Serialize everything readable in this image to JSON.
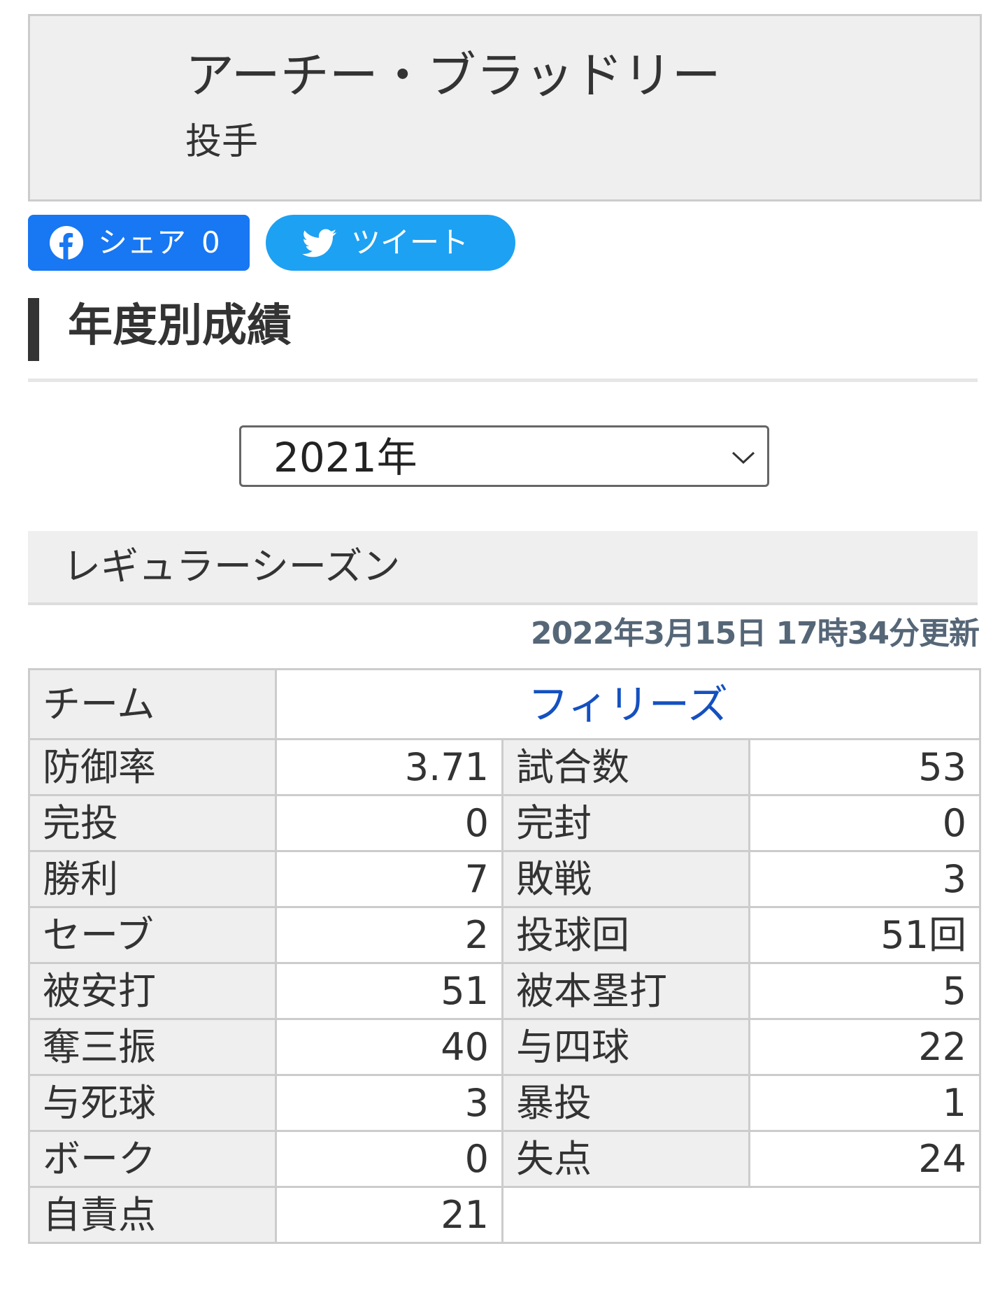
{
  "player": {
    "name": "アーチー・ブラッドリー",
    "position": "投手"
  },
  "share": {
    "facebook_label": "シェア",
    "facebook_count": "0",
    "tweet_label": "ツイート",
    "facebook_color": "#1877f2",
    "twitter_color": "#1da1f2"
  },
  "section": {
    "title": "年度別成績"
  },
  "year_select": {
    "value": "2021年"
  },
  "season": {
    "title": "レギュラーシーズン",
    "updated": "2022年3月15日 17時34分更新"
  },
  "stats": {
    "team_label": "チーム",
    "team_name": "フィリーズ",
    "rows": [
      [
        "防御率",
        "3.71",
        "試合数",
        "53"
      ],
      [
        "完投",
        "0",
        "完封",
        "0"
      ],
      [
        "勝利",
        "7",
        "敗戦",
        "3"
      ],
      [
        "セーブ",
        "2",
        "投球回",
        "51回"
      ],
      [
        "被安打",
        "51",
        "被本塁打",
        "5"
      ],
      [
        "奪三振",
        "40",
        "与四球",
        "22"
      ],
      [
        "与死球",
        "3",
        "暴投",
        "1"
      ],
      [
        "ボーク",
        "0",
        "失点",
        "24"
      ]
    ],
    "last_row": [
      "自責点",
      "21"
    ]
  }
}
